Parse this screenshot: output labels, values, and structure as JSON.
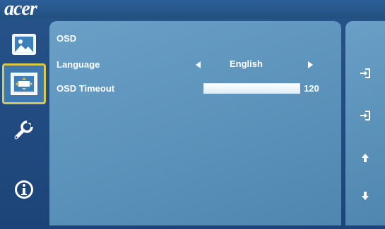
{
  "brand": {
    "logo_text": "acer"
  },
  "nav": [
    {
      "id": "picture",
      "icon": "picture-icon",
      "selected": false
    },
    {
      "id": "osd",
      "icon": "osd-icon",
      "selected": true
    },
    {
      "id": "settings",
      "icon": "wrench-icon",
      "selected": false
    },
    {
      "id": "information",
      "icon": "info-icon",
      "selected": false
    }
  ],
  "panel": {
    "title": "OSD",
    "language": {
      "label": "Language",
      "value": "English"
    },
    "osd_timeout": {
      "label": "OSD Timeout",
      "value": "120",
      "level_fraction": 1.0
    }
  },
  "keys": [
    {
      "icon": "enter-icon"
    },
    {
      "icon": "exit-icon"
    },
    {
      "icon": "up-arrow-icon"
    },
    {
      "icon": "down-arrow-icon"
    }
  ],
  "colors": {
    "background": "#1d4478",
    "panel": "#5b92bb",
    "selection_border": "#d9c84a",
    "text": "#ffffff"
  }
}
